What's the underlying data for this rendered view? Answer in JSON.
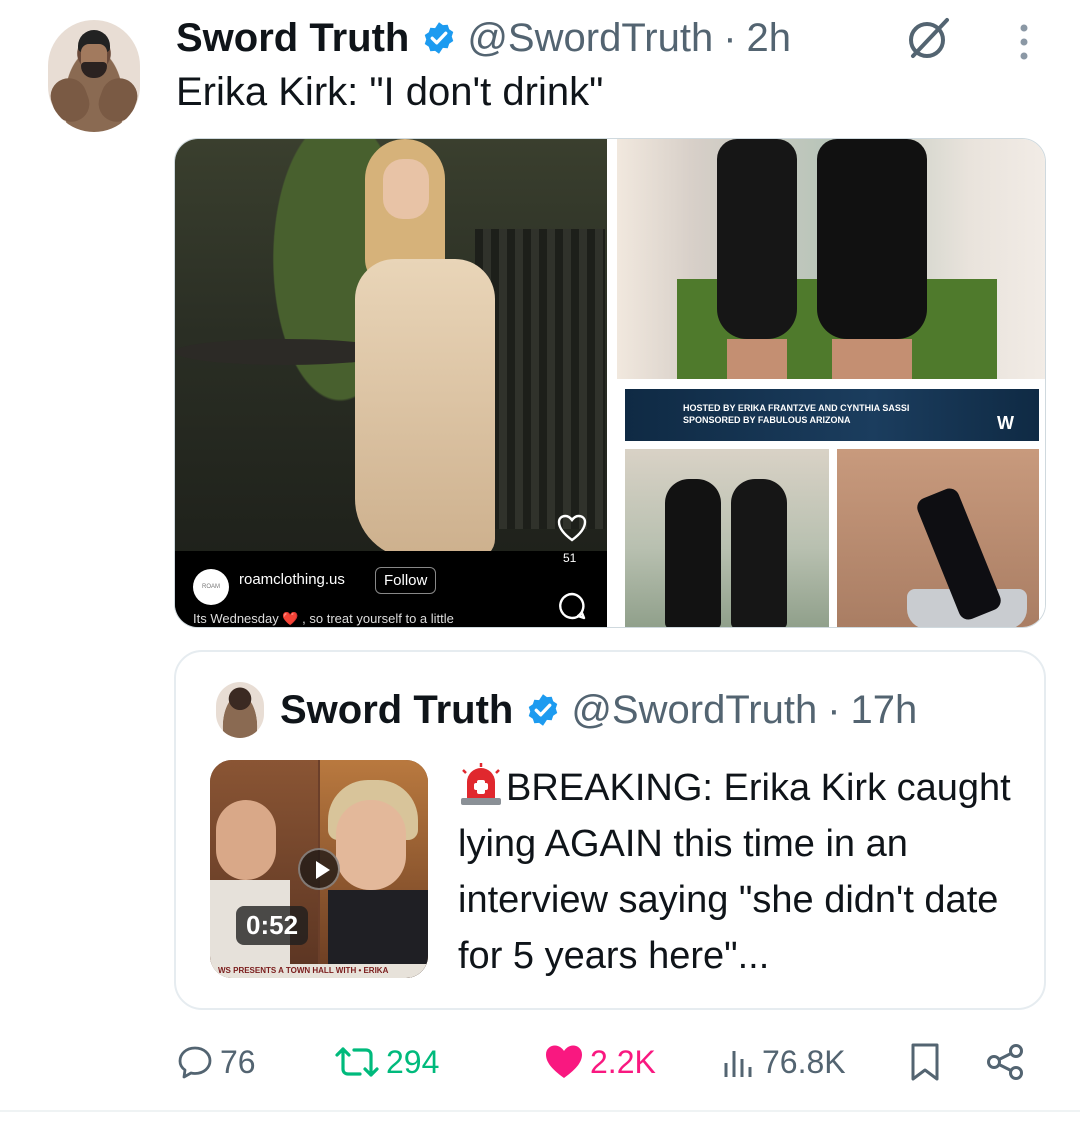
{
  "tweet": {
    "author_name": "Sword Truth",
    "handle": "@SwordTruth",
    "separator": "·",
    "time": "2h",
    "text": "Erika Kirk: \"I don't drink\""
  },
  "media": {
    "left_image": {
      "account": "roamclothing.us",
      "logo_text": "ROAM",
      "follow_label": "Follow",
      "likes": "51",
      "caption": "Its Wednesday ❤️ , so treat yourself to a little"
    },
    "bottom_right_banner": {
      "line1": "HOSTED BY ERIKA FRANTZVE AND CYNTHIA SASSI",
      "line2": "SPONSORED BY FABULOUS ARIZONA",
      "logo": "W"
    }
  },
  "quoted": {
    "author_name": "Sword Truth",
    "handle": "@SwordTruth",
    "separator": "·",
    "time": "17h",
    "video_duration": "0:52",
    "ticker": "WS PRESENTS  A TOWN HALL WITH • ERIKA",
    "text": "BREAKING: Erika Kirk caught lying AGAIN this time in an interview saying \"she didn't date for 5 years here\"..."
  },
  "actions": {
    "replies": "76",
    "retweets": "294",
    "likes": "2.2K",
    "views": "76.8K"
  },
  "colors": {
    "verified": "#1d9bf0",
    "retweet": "#00ba7c",
    "like": "#f91880",
    "muted": "#536471"
  },
  "icons": [
    "verified-badge-icon",
    "grok-icon",
    "more-icon",
    "heart-icon",
    "comment-icon",
    "play-icon",
    "alarm-icon",
    "reply-icon",
    "retweet-icon",
    "like-icon",
    "views-icon",
    "bookmark-icon",
    "share-icon"
  ]
}
